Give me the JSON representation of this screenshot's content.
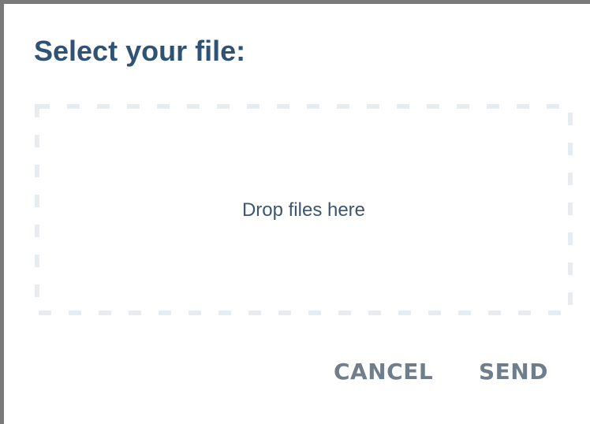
{
  "dialog": {
    "title": "Select your file:",
    "dropzone": {
      "text": "Drop files here",
      "border_color": "#e7ecf1"
    },
    "buttons": {
      "cancel_label": "CANCEL",
      "send_label": "SEND"
    },
    "colors": {
      "title": "#2f5375",
      "button_text": "#6e7e8d",
      "frame_border": "#7a7a7a"
    }
  }
}
